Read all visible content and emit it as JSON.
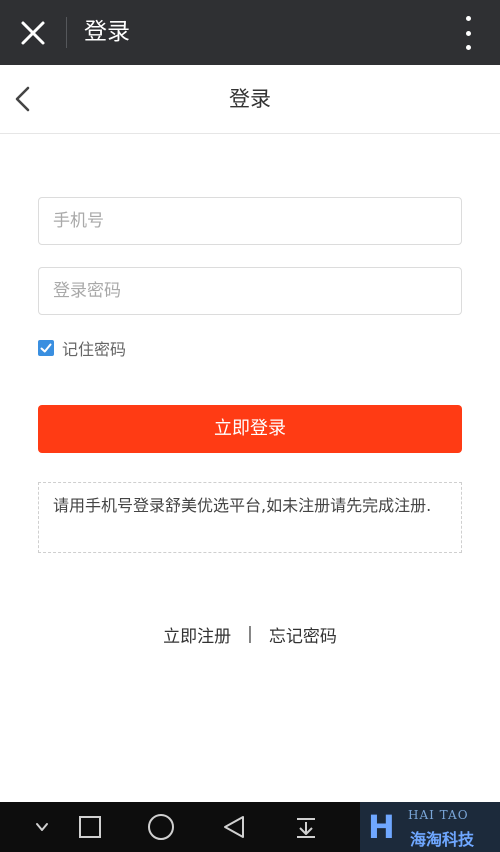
{
  "topbar": {
    "title": "登录",
    "close_icon": "close-icon",
    "more_icon": "more-vertical-icon"
  },
  "header": {
    "title": "登录",
    "back_icon": "chevron-left-icon"
  },
  "form": {
    "phone_placeholder": "手机号",
    "phone_value": "",
    "password_placeholder": "登录密码",
    "password_value": "",
    "remember_label": "记住密码",
    "remember_checked": true,
    "login_label": "立即登录"
  },
  "notice": {
    "text": "请用手机号登录舒美优选平台,如未注册请先完成注册."
  },
  "links": {
    "register": "立即注册",
    "separator": "|",
    "forgot": "忘记密码"
  },
  "watermark": {
    "top": "HAI TAO",
    "bottom": "海淘科技"
  },
  "colors": {
    "topbar_bg": "#2f3033",
    "primary": "#ff3b14",
    "checkbox": "#3a8fe0",
    "navbar_bg": "#0d0d0d"
  },
  "navbar": {
    "icons": [
      "chevron-down-icon",
      "square-icon",
      "circle-icon",
      "triangle-back-icon",
      "download-arrow-icon"
    ]
  }
}
